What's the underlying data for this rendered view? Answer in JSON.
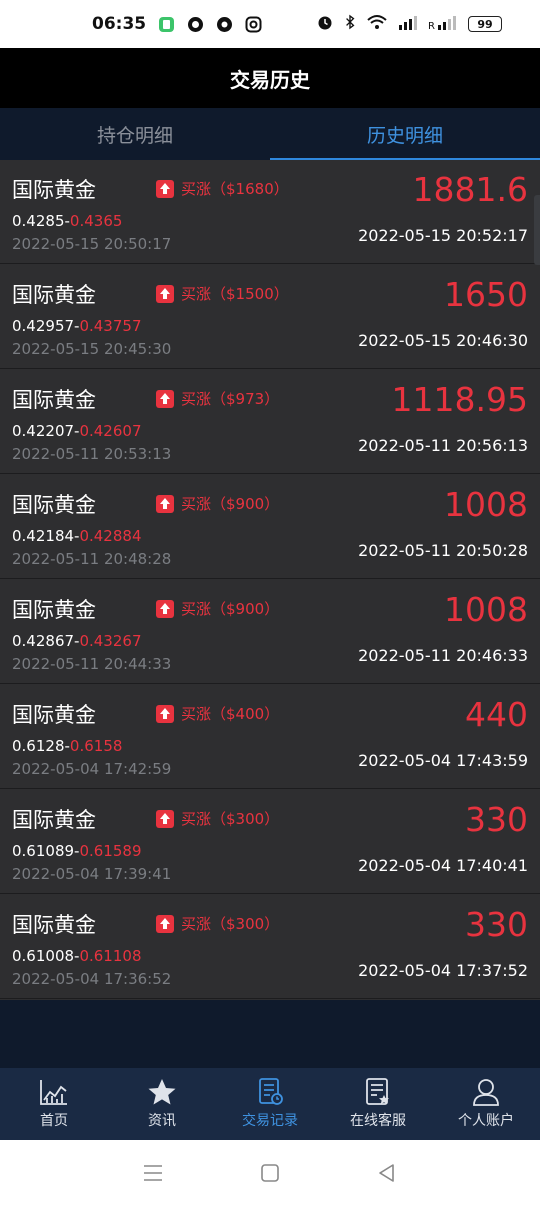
{
  "status_bar": {
    "time": "06:35",
    "battery": "99"
  },
  "header": {
    "title": "交易历史"
  },
  "tabs": [
    {
      "label": "持仓明细",
      "active": false
    },
    {
      "label": "历史明细",
      "active": true
    }
  ],
  "trades": [
    {
      "name": "国际黄金",
      "direction": "买涨",
      "stake": "（$1680）",
      "amount": "1881.6",
      "open_price": "0.4285",
      "separator": "-",
      "close_price": "0.4365",
      "open_time": "2022-05-15 20:50:17",
      "close_time": "2022-05-15 20:52:17"
    },
    {
      "name": "国际黄金",
      "direction": "买涨",
      "stake": "（$1500）",
      "amount": "1650",
      "open_price": "0.42957",
      "separator": "-",
      "close_price": "0.43757",
      "open_time": "2022-05-15 20:45:30",
      "close_time": "2022-05-15 20:46:30"
    },
    {
      "name": "国际黄金",
      "direction": "买涨",
      "stake": "（$973）",
      "amount": "1118.95",
      "open_price": "0.42207",
      "separator": "-",
      "close_price": "0.42607",
      "open_time": "2022-05-11 20:53:13",
      "close_time": "2022-05-11 20:56:13"
    },
    {
      "name": "国际黄金",
      "direction": "买涨",
      "stake": "（$900）",
      "amount": "1008",
      "open_price": "0.42184",
      "separator": "-",
      "close_price": "0.42884",
      "open_time": "2022-05-11 20:48:28",
      "close_time": "2022-05-11 20:50:28"
    },
    {
      "name": "国际黄金",
      "direction": "买涨",
      "stake": "（$900）",
      "amount": "1008",
      "open_price": "0.42867",
      "separator": "-",
      "close_price": "0.43267",
      "open_time": "2022-05-11 20:44:33",
      "close_time": "2022-05-11 20:46:33"
    },
    {
      "name": "国际黄金",
      "direction": "买涨",
      "stake": "（$400）",
      "amount": "440",
      "open_price": "0.6128",
      "separator": "-",
      "close_price": "0.6158",
      "open_time": "2022-05-04 17:42:59",
      "close_time": "2022-05-04 17:43:59"
    },
    {
      "name": "国际黄金",
      "direction": "买涨",
      "stake": "（$300）",
      "amount": "330",
      "open_price": "0.61089",
      "separator": "-",
      "close_price": "0.61589",
      "open_time": "2022-05-04 17:39:41",
      "close_time": "2022-05-04 17:40:41"
    },
    {
      "name": "国际黄金",
      "direction": "买涨",
      "stake": "（$300）",
      "amount": "330",
      "open_price": "0.61008",
      "separator": "-",
      "close_price": "0.61108",
      "open_time": "2022-05-04 17:36:52",
      "close_time": "2022-05-04 17:37:52"
    }
  ],
  "bottom_nav": [
    {
      "label": "首页",
      "icon": "chart-icon",
      "active": false
    },
    {
      "label": "资讯",
      "icon": "star-icon",
      "active": false
    },
    {
      "label": "交易记录",
      "icon": "records-icon",
      "active": true
    },
    {
      "label": "在线客服",
      "icon": "service-icon",
      "active": false
    },
    {
      "label": "个人账户",
      "icon": "person-icon",
      "active": false
    }
  ],
  "colors": {
    "up_red": "#e8333f",
    "accent_blue": "#3f92e0",
    "header_bg": "#000000",
    "row_bg": "#2e2e30",
    "nav_bg": "#1a2a44"
  }
}
